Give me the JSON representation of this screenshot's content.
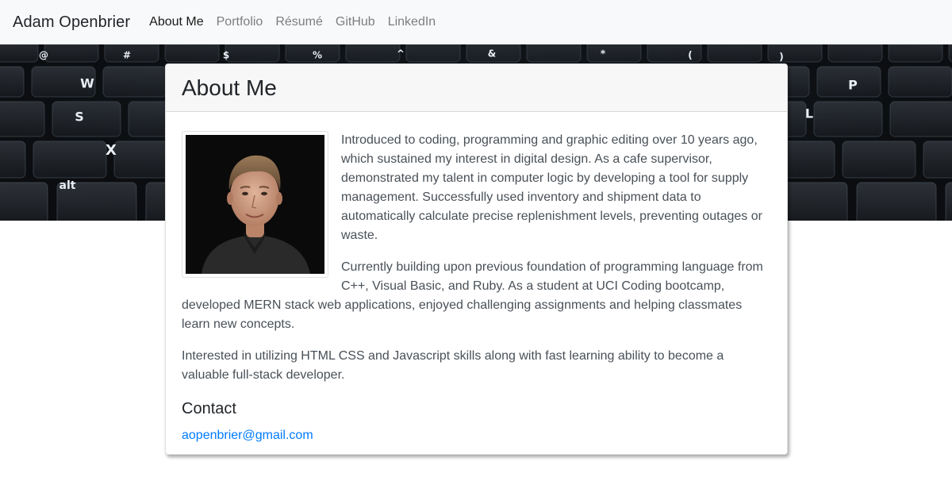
{
  "navbar": {
    "brand": "Adam Openbrier",
    "links": [
      {
        "label": "About Me",
        "active": true
      },
      {
        "label": "Portfolio",
        "active": false
      },
      {
        "label": "Résumé",
        "active": false
      },
      {
        "label": "GitHub",
        "active": false
      },
      {
        "label": "LinkedIn",
        "active": false
      }
    ]
  },
  "hero": {
    "keycaps": [
      "@",
      "#",
      "$",
      "%",
      "^",
      "&",
      "*",
      "(",
      ")",
      "W",
      "S",
      "X",
      "alt",
      "P",
      "L"
    ]
  },
  "card": {
    "title": "About Me",
    "paragraphs": [
      "Introduced to coding, programming and graphic editing over 10 years ago, which sustained my interest in digital design. As a cafe supervisor, demonstrated my talent in computer logic by developing a tool for supply management. Successfully used inventory and shipment data to automatically calculate precise replenishment levels, preventing outages or waste.",
      "Currently building upon previous foundation of programming language from C++, Visual Basic, and Ruby. As a student at UCI Coding bootcamp, developed MERN stack web applications, enjoyed challenging assignments and helping classmates learn new concepts.",
      "Interested in utilizing HTML CSS and Javascript skills along with fast learning ability to become a valuable full-stack developer."
    ],
    "contact_heading": "Contact",
    "email": "aopenbrier@gmail.com"
  },
  "colors": {
    "link": "#007bff",
    "navbar_bg": "#f8f9fa",
    "card_header_bg": "#f7f7f7"
  }
}
